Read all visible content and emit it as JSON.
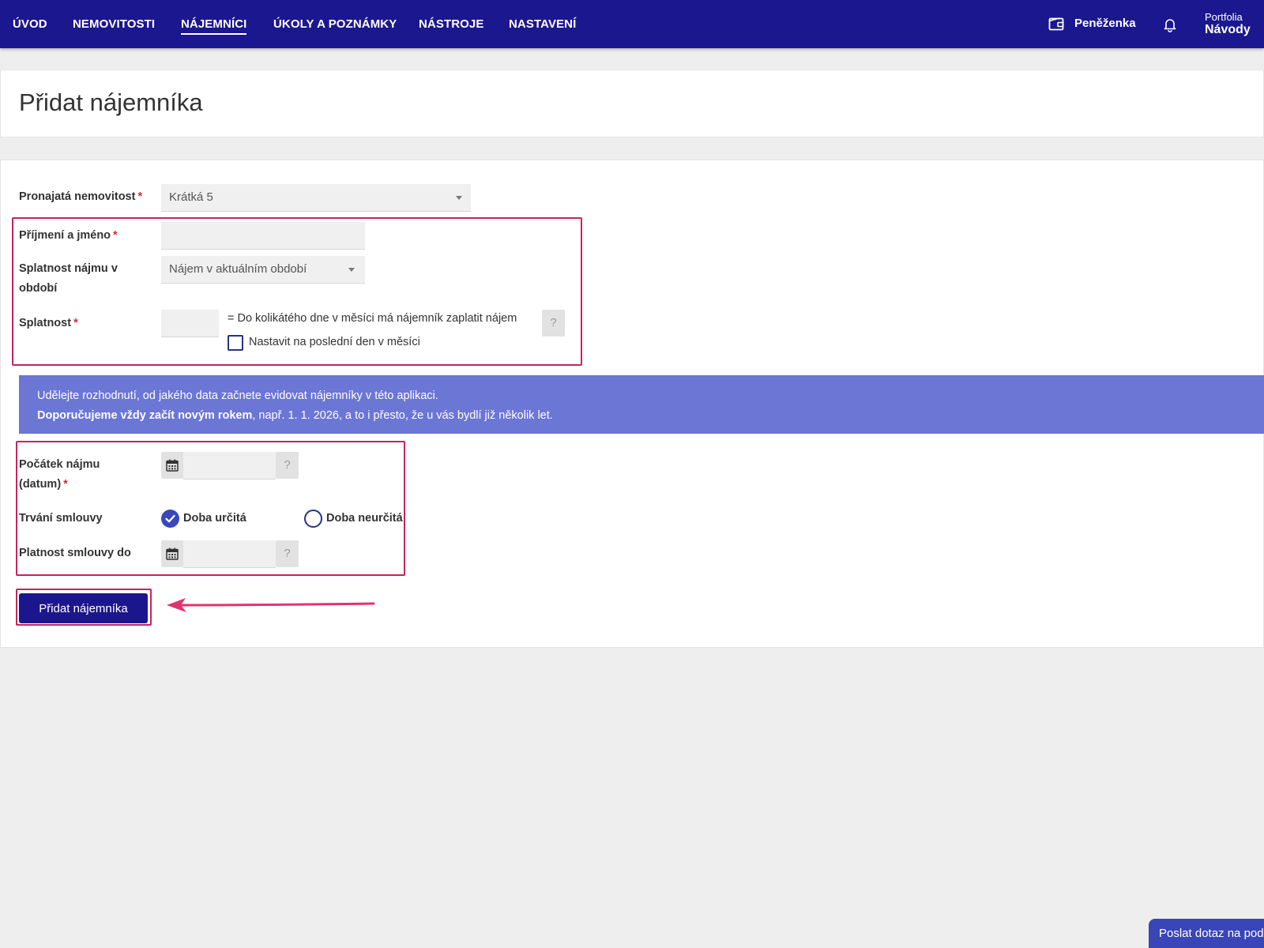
{
  "nav": {
    "items": [
      "ÚVOD",
      "NEMOVITOSTI",
      "NÁJEMNÍCI",
      "ÚKOLY A POZNÁMKY",
      "NÁSTROJE",
      "NASTAVENÍ"
    ],
    "active_index": 2,
    "wallet_label": "Peněženka",
    "portfolio_small": "Portfolia",
    "portfolio_big": "Návody"
  },
  "page": {
    "title": "Přidat nájemníka"
  },
  "form": {
    "property": {
      "label": "Pronajatá nemovitost",
      "required_mark": "*",
      "value": "Krátká 5"
    },
    "name": {
      "label": "Příjmení a jméno",
      "required_mark": "*",
      "value": ""
    },
    "due_period": {
      "label": "Splatnost nájmu v období",
      "value": "Nájem v aktuálním období"
    },
    "due_day": {
      "label": "Splatnost",
      "required_mark": "*",
      "value": "",
      "hint": "= Do kolikátého dne v měsíci má nájemník zaplatit nájem",
      "checkbox_label": "Nastavit na poslední den v měsíci",
      "checkbox_checked": false,
      "help": "?"
    },
    "banner": {
      "line1": "Udělejte rozhodnutí, od jakého data začnete evidovat nájemníky v této aplikaci.",
      "line2_bold": "Doporučujeme vždy začít novým rokem",
      "line2_rest": ", např. 1. 1. 2026, a to i přesto, že u vás bydlí již několik let."
    },
    "start_date": {
      "label_line1": "Počátek nájmu",
      "label_line2": "(datum)",
      "required_mark": "*",
      "value": "",
      "help": "?"
    },
    "contract_duration": {
      "label": "Trvání smlouvy",
      "options": [
        "Doba určitá",
        "Doba neurčitá"
      ],
      "selected_index": 0
    },
    "valid_until": {
      "label": "Platnost smlouvy do",
      "value": "",
      "help": "?"
    },
    "submit_label": "Přidat nájemníka"
  },
  "help_widget": {
    "label": "Poslat dotaz na pod"
  },
  "colors": {
    "nav_bg": "#1b178e",
    "banner_bg": "#6b76d5",
    "highlight": "#c5245e",
    "arrow": "#e2336f",
    "required": "#d9283a",
    "accent": "#3848b8"
  }
}
